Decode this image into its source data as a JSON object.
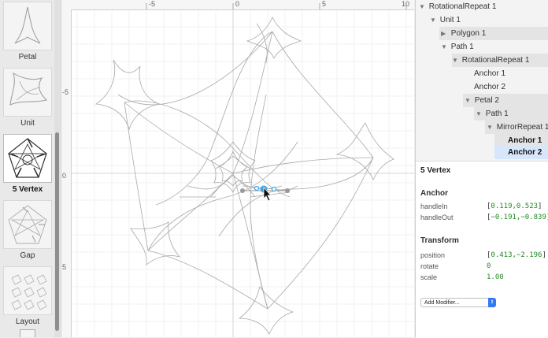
{
  "thumbnails": [
    {
      "label": "Petal",
      "selected": false
    },
    {
      "label": "Unit",
      "selected": false
    },
    {
      "label": "5 Vertex",
      "selected": true
    },
    {
      "label": "Gap",
      "selected": false
    },
    {
      "label": "Layout",
      "selected": false
    }
  ],
  "rulers": {
    "horizontal": [
      "-5",
      "0",
      "5",
      "10"
    ],
    "vertical": [
      "-5",
      "0",
      "5"
    ]
  },
  "tree": [
    {
      "label": "RotationalRepeat 1",
      "expanded": true
    },
    {
      "label": "Unit 1",
      "expanded": true
    },
    {
      "label": "Polygon 1",
      "expanded": false
    },
    {
      "label": "Path 1",
      "expanded": true
    },
    {
      "label": "RotationalRepeat 1",
      "expanded": true
    },
    {
      "label": "Anchor 1"
    },
    {
      "label": "Anchor 2"
    },
    {
      "label": "Petal 2",
      "expanded": true
    },
    {
      "label": "Path 1",
      "expanded": true
    },
    {
      "label": "MirrorRepeat 1",
      "expanded": true
    },
    {
      "label": "Anchor 1"
    },
    {
      "label": "Anchor 2",
      "selected": true
    }
  ],
  "inspector": {
    "title": "5 Vertex",
    "anchor_heading": "Anchor",
    "handleIn_label": "handleIn",
    "handleIn_value": "0.119,0.523",
    "handleOut_label": "handleOut",
    "handleOut_value": "−0.191,−0.839",
    "transform_heading": "Transform",
    "position_label": "position",
    "position_value": "0.413,−2.196",
    "rotate_label": "rotate",
    "rotate_value": "0",
    "scale_label": "scale",
    "scale_value": "1.00",
    "add_modifier_label": "Add Modifier..."
  },
  "colors": {
    "selection_blue": "#3fa3e0",
    "value_green": "#1f8a1f",
    "tree_selected": "#d7e6fb"
  }
}
